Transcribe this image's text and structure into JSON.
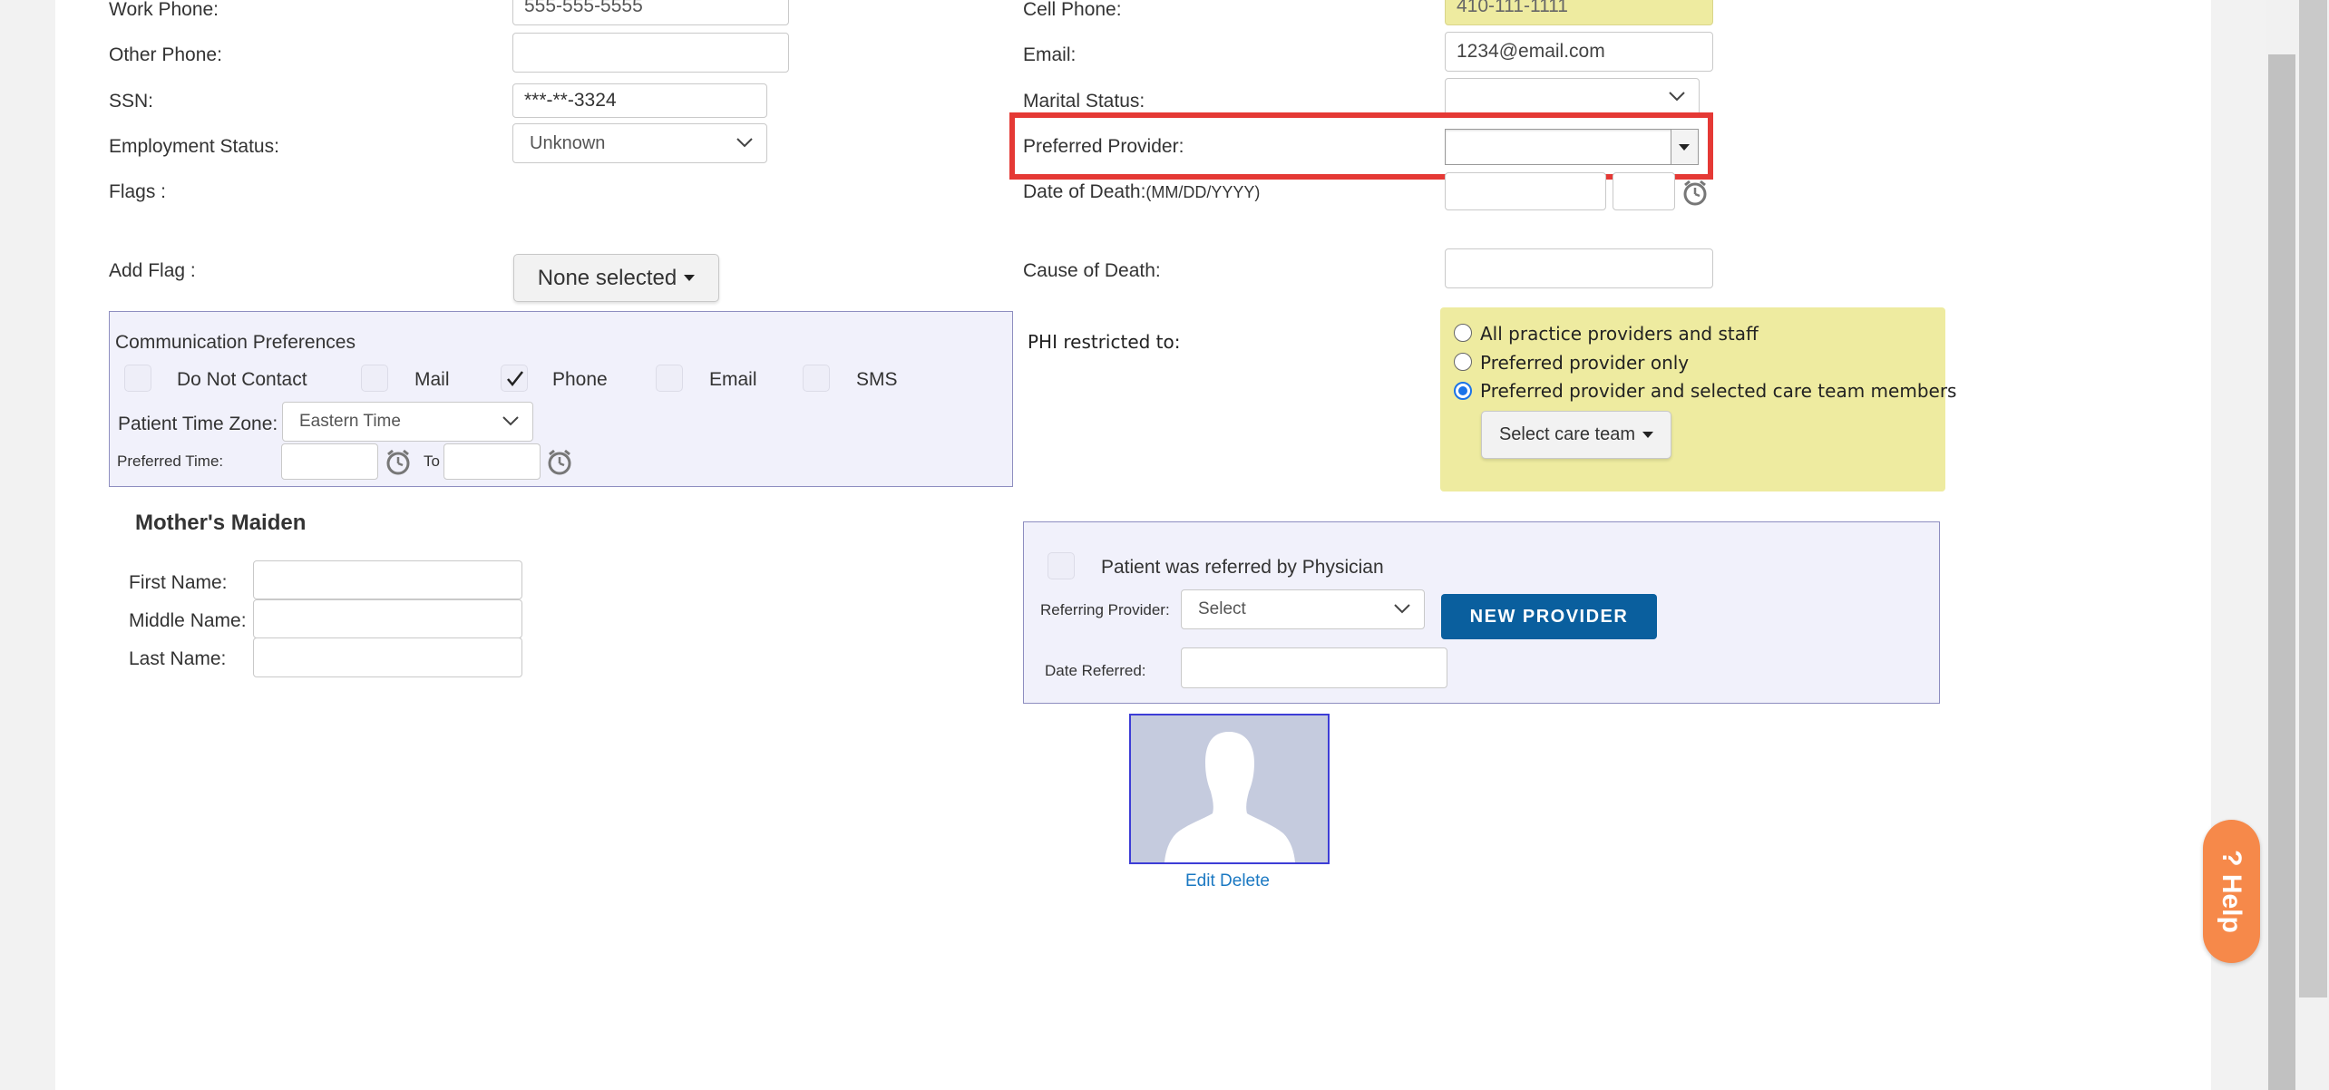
{
  "contact": {
    "work_phone_label": "Work Phone:",
    "work_phone_value": "555-555-5555",
    "other_phone_label": "Other Phone:",
    "other_phone_value": "",
    "ssn_label": "SSN:",
    "ssn_value": "***-**-3324",
    "employment_status_label": "Employment Status:",
    "employment_status_value": "Unknown",
    "flags_label": "Flags :",
    "add_flag_label": "Add Flag :",
    "add_flag_button": "None selected",
    "cell_phone_label": "Cell Phone:",
    "cell_phone_value": "410-111-1111",
    "email_label": "Email:",
    "email_value": "1234@email.com",
    "marital_status_label": "Marital Status:",
    "marital_status_value": "",
    "preferred_provider_label": "Preferred Provider:",
    "preferred_provider_value": "",
    "date_of_death_label": "Date of Death:",
    "date_of_death_format": "(MM/DD/YYYY)",
    "cause_of_death_label": "Cause of Death:"
  },
  "communication": {
    "title": "Communication Preferences",
    "options": [
      {
        "label": "Do Not Contact",
        "checked": false
      },
      {
        "label": "Mail",
        "checked": false
      },
      {
        "label": "Phone",
        "checked": true
      },
      {
        "label": "Email",
        "checked": false
      },
      {
        "label": "SMS",
        "checked": false
      }
    ],
    "time_zone_label": "Patient Time Zone:",
    "time_zone_value": "Eastern Time",
    "preferred_time_label": "Preferred Time:",
    "to_label": "To"
  },
  "phi": {
    "label": "PHI restricted to:",
    "options": [
      {
        "label": "All practice providers and staff",
        "selected": false
      },
      {
        "label": "Preferred provider only",
        "selected": false
      },
      {
        "label": "Preferred provider and selected care team members",
        "selected": true
      }
    ],
    "care_team_button": "Select care team"
  },
  "mothers_maiden": {
    "title": "Mother's Maiden",
    "first_name_label": "First Name:",
    "middle_name_label": "Middle Name:",
    "last_name_label": "Last Name:"
  },
  "referral": {
    "checkbox_label": "Patient was referred by Physician",
    "referring_provider_label": "Referring Provider:",
    "referring_provider_value": "Select",
    "new_provider_button": "NEW PROVIDER",
    "date_referred_label": "Date Referred:"
  },
  "photo": {
    "edit_label": "Edit",
    "delete_label": "Delete"
  },
  "help": {
    "label": "Help",
    "icon": "?"
  },
  "colors": {
    "highlight_red": "#e53935",
    "primary_blue": "#0a5f9e",
    "help_orange": "#f6894a",
    "phi_yellow": "#eeeba0",
    "panel_lavender": "#f1f1fb"
  }
}
